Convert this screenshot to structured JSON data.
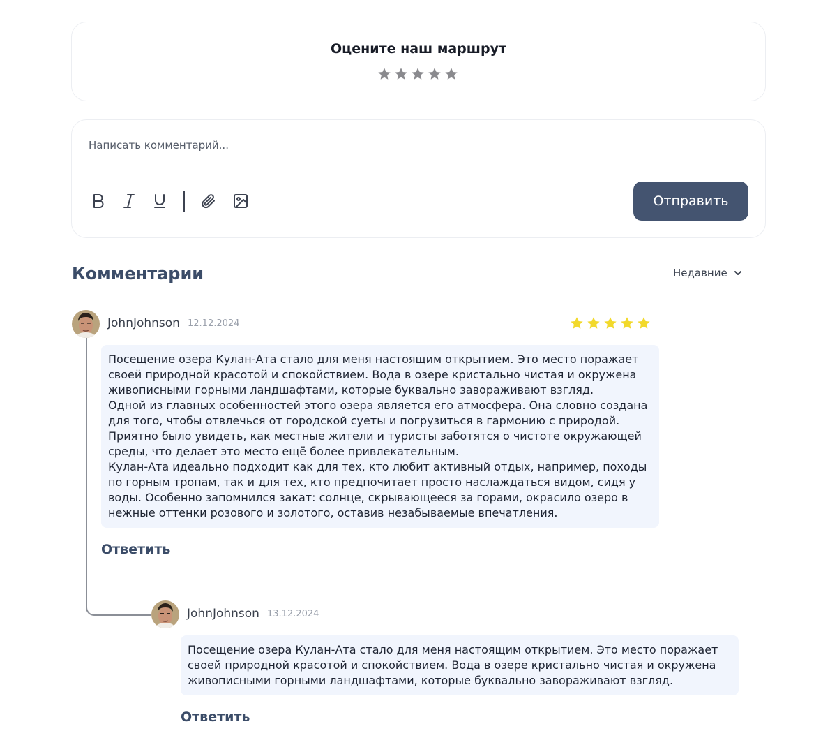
{
  "rating": {
    "title": "Оцените наш маршрут",
    "stars_total": 5,
    "stars_selected": 0,
    "star_color_empty": "#8a8a8e"
  },
  "composer": {
    "placeholder": "Написать комментарий...",
    "toolbar": [
      "bold-icon",
      "italic-icon",
      "underline-icon",
      "attach-icon",
      "image-icon"
    ],
    "send_label": "Отправить",
    "send_color": "#445470"
  },
  "comments_section": {
    "title": "Комментарии",
    "sort_label": "Недавние"
  },
  "comments": [
    {
      "author": "JohnJohnson",
      "date": "12.12.2024",
      "rating": 5,
      "star_color": "#f2d92b",
      "paragraphs": [
        "Посещение озера Кулан-Ата стало для меня настоящим открытием. Это место поражает своей природной красотой и спокойствием. Вода в озере кристально чистая и окружена живописными горными ландшафтами, которые буквально завораживают взгляд.",
        "Одной из главных особенностей этого озера является его атмосфера. Она словно создана для того, чтобы отвлечься от городской суеты и погрузиться в гармонию с природой. Приятно было увидеть, как местные жители и туристы заботятся о чистоте окружающей среды, что делает это место ещё более привлекательным.",
        "Кулан-Ата идеально подходит как для тех, кто любит активный отдых, например, походы по горным тропам, так и для тех, кто предпочитает просто наслаждаться видом, сидя у воды. Особенно запомнился закат: солнце, скрывающееся за горами, окрасило озеро в нежные оттенки розового и золотого, оставив незабываемые впечатления."
      ],
      "reply_label": "Ответить"
    },
    {
      "author": "JohnJohnson",
      "date": "13.12.2024",
      "paragraphs": [
        "Посещение озера Кулан-Ата стало для меня настоящим открытием. Это место поражает своей природной красотой и спокойствием. Вода в озере кристально чистая и окружена живописными горными ландшафтами, которые буквально завораживают взгляд."
      ],
      "reply_label": "Ответить"
    }
  ]
}
